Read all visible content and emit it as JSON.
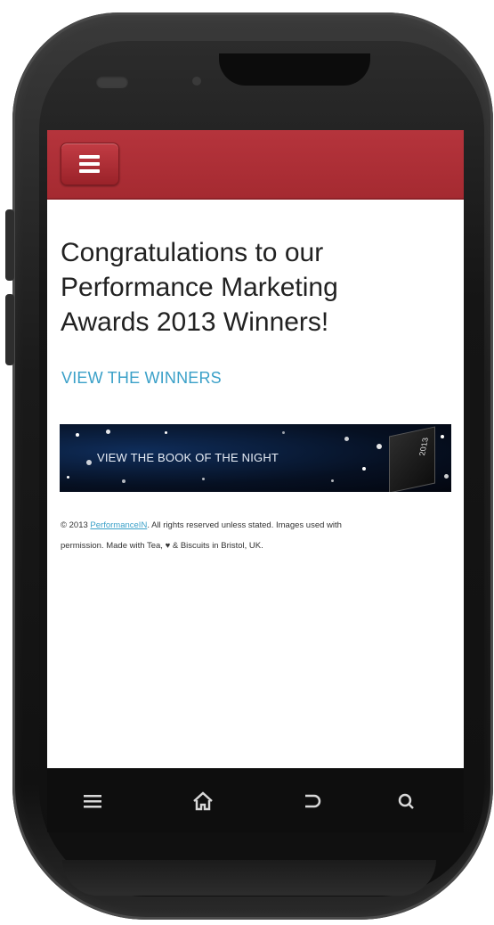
{
  "device": {
    "type": "android-phone",
    "nav_icons": [
      "menu-icon",
      "home-icon",
      "back-icon",
      "search-icon"
    ]
  },
  "theme": {
    "brand_red": "#a52a31",
    "link_blue": "#3aa0c8",
    "text_dark": "#222222"
  },
  "header": {
    "menu_icon": "hamburger-icon"
  },
  "main": {
    "headline_lines": [
      "Congratulations to our",
      "Performance Marketing",
      "Awards 2013 Winners!"
    ],
    "cta_link": "VIEW THE WINNERS",
    "banner": {
      "text": "VIEW THE BOOK OF THE NIGHT",
      "book_label": "2013"
    }
  },
  "footer": {
    "line1_prefix": "© 2013 ",
    "link": "PerformanceIN",
    "line1_suffix": ". All rights reserved unless stated. Images used with",
    "line2": "permission. Made with Tea, ♥ & Biscuits in Bristol, UK."
  }
}
